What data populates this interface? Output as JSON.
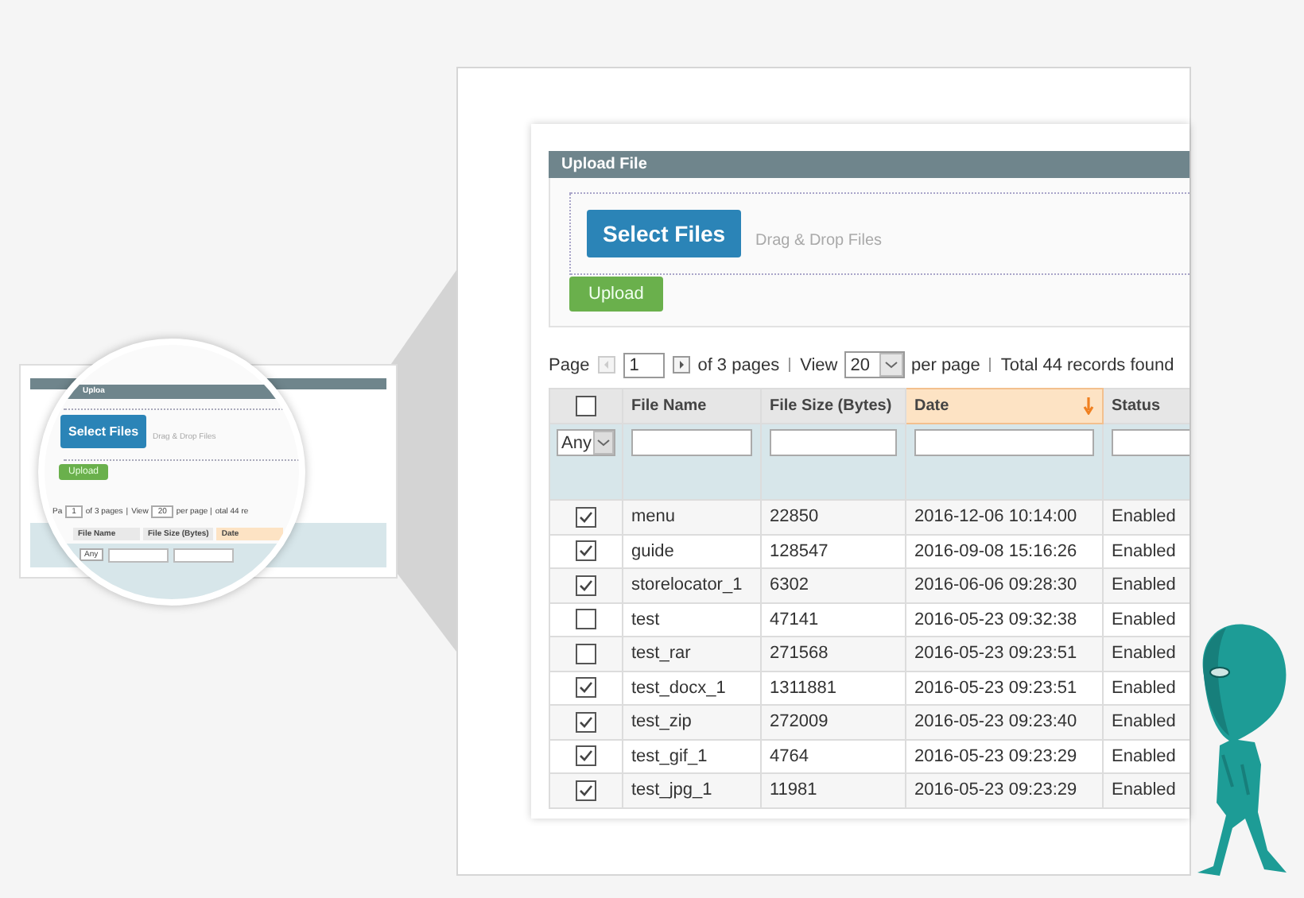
{
  "thumbnail": {
    "header": "Uploa",
    "select_button": "Select Files",
    "drop_hint": "Drag & Drop Files",
    "upload_button": "Upload",
    "pager": {
      "page_label": "Pa",
      "page": "1",
      "of_pages": "of 3 pages",
      "separator": "|",
      "view": "View",
      "per_page_value": "20",
      "per_page": "per page |",
      "total": "otal 44 re"
    },
    "columns": [
      "File Name",
      "File Size (Bytes)",
      "Date"
    ],
    "type_filter": "Any"
  },
  "panel": {
    "title": "Upload File",
    "select_button": "Select Files",
    "drop_hint": "Drag & Drop Files",
    "upload_button": "Upload"
  },
  "pager": {
    "page_label": "Page",
    "page": "1",
    "of_pages": "of 3 pages",
    "view": "View",
    "per_page_value": "20",
    "per_page": "per page",
    "total": "Total 44 records found"
  },
  "table": {
    "select_all": false,
    "type_filter": "Any",
    "columns": [
      {
        "label": "File Name",
        "sorted": false
      },
      {
        "label": "File Size (Bytes)",
        "sorted": false
      },
      {
        "label": "Date",
        "sorted": true
      },
      {
        "label": "Status",
        "sorted": false
      }
    ],
    "rows": [
      {
        "checked": true,
        "name": "menu",
        "size": "22850",
        "date": "2016-12-06 10:14:00",
        "status": "Enabled"
      },
      {
        "checked": true,
        "name": "guide",
        "size": "128547",
        "date": "2016-09-08 15:16:26",
        "status": "Enabled"
      },
      {
        "checked": true,
        "name": "storelocator_1",
        "size": "6302",
        "date": "2016-06-06 09:28:30",
        "status": "Enabled"
      },
      {
        "checked": false,
        "name": "test",
        "size": "47141",
        "date": "2016-05-23 09:32:38",
        "status": "Enabled"
      },
      {
        "checked": false,
        "name": "test_rar",
        "size": "271568",
        "date": "2016-05-23 09:23:51",
        "status": "Enabled"
      },
      {
        "checked": true,
        "name": "test_docx_1",
        "size": "1311881",
        "date": "2016-05-23 09:23:51",
        "status": "Enabled"
      },
      {
        "checked": true,
        "name": "test_zip",
        "size": "272009",
        "date": "2016-05-23 09:23:40",
        "status": "Enabled"
      },
      {
        "checked": true,
        "name": "test_gif_1",
        "size": "4764",
        "date": "2016-05-23 09:23:29",
        "status": "Enabled"
      },
      {
        "checked": true,
        "name": "test_jpg_1",
        "size": "11981",
        "date": "2016-05-23 09:23:29",
        "status": "Enabled"
      }
    ]
  }
}
